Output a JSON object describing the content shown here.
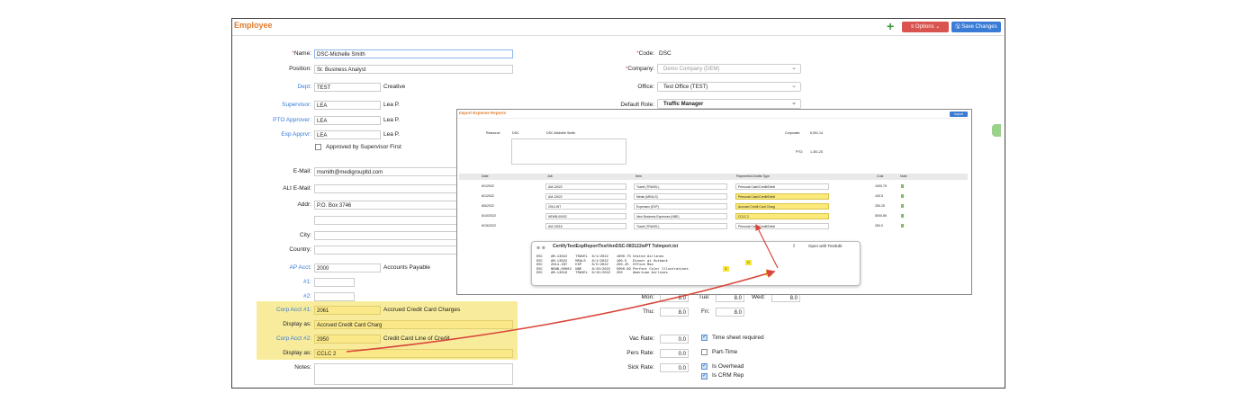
{
  "header": {
    "title": "Employee",
    "options_label": "Options",
    "save_label": "Save Changes"
  },
  "left": {
    "name_label": "Name:",
    "name": "DSC-Michelle Smith",
    "position_label": "Position:",
    "position": "Sr. Business Analyst",
    "dept_label": "Dept:",
    "dept": "TEST",
    "dept_desc": "Creative",
    "supervisor_label": "Supervisor:",
    "supervisor": "LEA",
    "supervisor_desc": "Lea P.",
    "pto_label": "PTO Approver:",
    "pto": "LEA",
    "pto_desc": "Lea P.",
    "exp_label": "Exp Apprvr:",
    "exp": "LEA",
    "exp_desc": "Lea P.",
    "approved_label": "Approved by Supervisor First",
    "email_label": "E-Mail:",
    "email": "msmith@medigroupltd.com",
    "alt_email_label": "ALt E-Mail:",
    "addr_label": "Addr:",
    "addr": "P.O. Box 3746",
    "city_label": "City:",
    "country_label": "Country:",
    "ap_label": "AP Acct:",
    "ap": "2000",
    "ap_desc": "Accounts Payable",
    "n1_label": "#1:",
    "n2_label": "#2:",
    "corp1_label": "Corp Acct #1:",
    "corp1": "2061",
    "corp1_desc": "Accrued Credit Card Charges",
    "disp1_label": "Display as:",
    "disp1": "Accrued Credit Card Charg",
    "corp2_label": "Corp Acct #2:",
    "corp2": "2950",
    "corp2_desc": "Credit Card Line of Credit",
    "disp2_label": "Display as:",
    "disp2": "CCLC 2",
    "notes_label": "Notes:"
  },
  "right": {
    "code_label": "Code:",
    "code": "DSC",
    "company_label": "Company:",
    "company": "Demo Company (DEM)",
    "office_label": "Office:",
    "office": "Test Office (TEST)",
    "role_label": "Default Role:",
    "role": "Traffic Manager",
    "mon_label": "Mon:",
    "mon": "8.0",
    "tue_label": "Tue:",
    "tue": "8.0",
    "wed_label": "Wed:",
    "wed": "8.0",
    "thu_label": "Thu:",
    "thu": "8.0",
    "fri_label": "Fri:",
    "fri": "8.0",
    "vac_label": "Vac Rate:",
    "vac": "0.0",
    "timesheet_label": "Time sheet required",
    "pers_label": "Pers Rate:",
    "pers": "0.0",
    "parttime_label": "Part-Time",
    "sick_label": "Sick Rate:",
    "sick": "0.0",
    "overhead_label": "Is Overhead",
    "crm_label": "Is CRM Rep"
  },
  "dialog": {
    "title": "Import Expense Reports",
    "button": "Import",
    "resource_label": "Resource:",
    "resource_code": "DSC",
    "resource_name": "DSC-Michelle Smith",
    "corporate_label": "Corporate:",
    "corporate": "6,051.14",
    "pto_label": "PTO:",
    "pto": "1,301.25",
    "columns": [
      "Date",
      "Job",
      "Item",
      "Payments/Credits Type",
      "Cost",
      "Note"
    ],
    "rows": [
      {
        "date": "8/1/2022",
        "job": "AM-13022",
        "item": "Travel (TRAVEL)",
        "pay": "Personal Cash/Credit/Debit",
        "cost": "1000.75",
        "hl": false
      },
      {
        "date": "8/1/2022",
        "job": "AM-13022",
        "item": "Meals (MEALS)",
        "pay": "Personal Cash/Credit/Debit",
        "cost": "100.5",
        "hl": true
      },
      {
        "date": "8/5/2022",
        "job": "2014-INT",
        "item": "Expenses (EXP)",
        "pay": "Accrued Credit Card Charg",
        "cost": "250.25",
        "hl": true
      },
      {
        "date": "8/10/2022",
        "job": "NEWB-00002",
        "item": "New Business Expenses (NBE)",
        "pay": "CCLC 2",
        "cost": "5000.89",
        "hl": true
      },
      {
        "date": "8/15/2022",
        "job": "AM-13016",
        "item": "Travel (TRAVEL)",
        "pay": "Personal Cash/Credit/Debit",
        "cost": "250.0",
        "hl": false
      }
    ]
  },
  "textfile": {
    "filename": "CertifyTestExpReportTestVenDSC-083122wPT ToImport.txt",
    "open_with": "Open with TextEdit",
    "lines": [
      "DSC    AM-13022    TRAVEL  8/1/2022    1000.75 United Airlines",
      "DSC    AM-13022    MEALS   8/1/2022    100.5   Dinner at Outback",
      "DSC    2014-INT    EXP     8/5/2022    250.25  Office Max",
      "DSC    NEWB-00002  NBE     8/10/2022   5000.89 Perfect Color Illustrations",
      "DSC    AM-13016    TRAVEL  8/15/2022   250     American Airlines"
    ],
    "badges": [
      "0",
      "1",
      "2"
    ]
  },
  "colors": {
    "accent": "#e07a2b",
    "highlight": "#fbe889",
    "arrow": "#d9453a",
    "save": "#3a7bd5",
    "options": "#d9534f"
  }
}
